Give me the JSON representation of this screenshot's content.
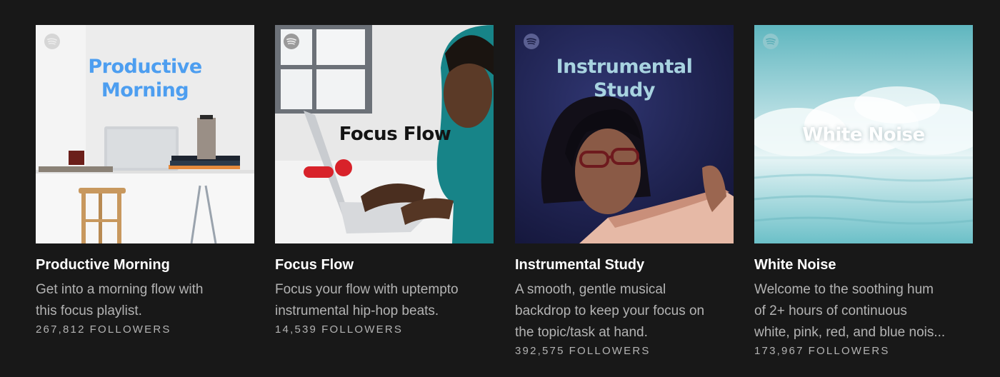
{
  "colors": {
    "background": "#181818",
    "title_text": "#ffffff",
    "secondary_text": "#b3b3b3",
    "productive_morning_title": "#4d9ef0",
    "instrumental_study_title": "#a8d3e0"
  },
  "logo_icon": "spotify-logo-icon",
  "playlists": [
    {
      "cover_title_lines": [
        "Productive",
        "Morning"
      ],
      "name": "Productive Morning",
      "description_lines": [
        "Get into a morning flow with",
        "this focus playlist."
      ],
      "followers_count": "267,812",
      "followers_label": "FOLLOWERS"
    },
    {
      "cover_title_lines": [
        "Focus Flow"
      ],
      "name": "Focus Flow",
      "description_lines": [
        "Focus your flow with uptempto",
        "instrumental hip-hop beats."
      ],
      "followers_count": "14,539",
      "followers_label": "FOLLOWERS"
    },
    {
      "cover_title_lines": [
        "Instrumental",
        "Study"
      ],
      "name": "Instrumental Study",
      "description_lines": [
        "A smooth, gentle musical",
        "backdrop to keep your focus on",
        "the topic/task at hand."
      ],
      "followers_count": "392,575",
      "followers_label": "FOLLOWERS"
    },
    {
      "cover_title_lines": [
        "White Noise"
      ],
      "name": "White Noise",
      "description_lines": [
        "Welcome to the soothing hum",
        "of 2+ hours of continuous",
        "white, pink, red, and blue nois..."
      ],
      "followers_count": "173,967",
      "followers_label": "FOLLOWERS"
    }
  ]
}
